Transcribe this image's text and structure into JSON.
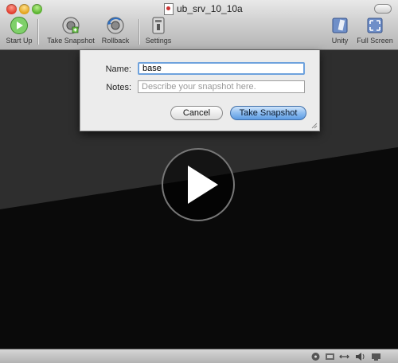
{
  "window": {
    "title": "ub_srv_10_10a"
  },
  "toolbar": {
    "start_up": "Start Up",
    "take_snapshot": "Take Snapshot",
    "rollback": "Rollback",
    "settings": "Settings",
    "unity": "Unity",
    "full_screen": "Full Screen"
  },
  "dialog": {
    "name_label": "Name:",
    "name_value": "base",
    "notes_label": "Notes:",
    "notes_placeholder": "Describe your snapshot here.",
    "cancel_label": "Cancel",
    "take_snapshot_label": "Take Snapshot"
  },
  "colors": {
    "accent": "#6ea2dd",
    "primary_button": "#8dbcf0"
  },
  "icons": [
    "close-icon",
    "minimize-icon",
    "zoom-icon",
    "document-icon",
    "start-up-icon",
    "camera-icon",
    "rollback-icon",
    "settings-icon",
    "unity-icon",
    "full-screen-icon",
    "play-icon",
    "resize-grip-icon",
    "cd-icon",
    "network-icon",
    "sound-icon",
    "usb-icon"
  ]
}
